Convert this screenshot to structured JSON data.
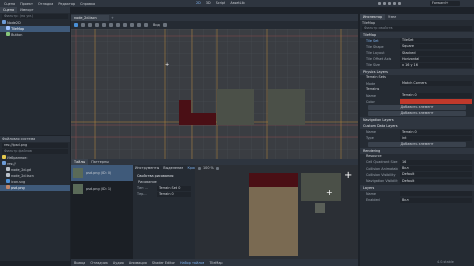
{
  "menu": {
    "items": [
      "Сцена",
      "Проект",
      "Отладка",
      "Редактор",
      "Справка"
    ],
    "scene_tab": "node_2d.tscn",
    "workspaces": [
      "2D",
      "3D",
      "Script",
      "AssetLib"
    ],
    "renderer": "Forward+"
  },
  "scene_dock": {
    "tabs": [
      "Сцена",
      "Импорт"
    ],
    "filter_placeholder": "Фильтр: (по ум.)",
    "nodes": [
      "Node2D",
      "TileMap",
      "Button"
    ]
  },
  "filesystem": {
    "title": "Файловая система",
    "path": "res://ipsd.png",
    "filter_placeholder": "Фильтр файлов",
    "items": [
      "Избранное:",
      "res://",
      "node_2d.gd",
      "node_2d.tscn",
      "icon.svg",
      "psd.png"
    ]
  },
  "viewport": {
    "toolbar": [
      "Вид",
      "Снимок"
    ],
    "zoom": "100 %"
  },
  "bottom_panel": {
    "tabs": [
      "Тайлы",
      "Паттерны"
    ],
    "tiles": [
      {
        "label": "psd.png (ID: 0)"
      },
      {
        "label": "psd.png (ID: 1)"
      }
    ],
    "tool_tabs": [
      "Инструменты",
      "Выделение",
      "Краска"
    ],
    "props_title": "Свойства рисования",
    "props_sub": "Рисование",
    "props": [
      {
        "k": "Тип ...",
        "v": "Terrain Set 0"
      },
      {
        "k": "Тер...",
        "v": "Terrain 0"
      }
    ],
    "atlas_zoom": "100 %"
  },
  "statusbar": {
    "items": [
      "Вывод",
      "Отладчик",
      "Аудио",
      "Анимация",
      "Shader Editor",
      "Набор тайлов",
      "TileMap"
    ],
    "version": "4.0.stable"
  },
  "inspector": {
    "tabs": [
      "Инспектор",
      "Узел"
    ],
    "path": "TileMap",
    "filter_placeholder": "Фильтр свойств",
    "object": "TileMap",
    "tileset_label": "Tile Set",
    "tileset_value": "TileSet",
    "props": [
      {
        "k": "Tile Shape",
        "v": "Square"
      },
      {
        "k": "Tile Layout",
        "v": "Stacked"
      },
      {
        "k": "Tile Offset Axis",
        "v": "Horizontal"
      },
      {
        "k": "Tile Size",
        "v": "x 16  y 16"
      }
    ],
    "sections": [
      {
        "title": "Physics Layers",
        "sub": "Terrain Sets",
        "rows": [
          {
            "k": "Mode",
            "v": "Match Corners"
          }
        ]
      },
      {
        "title": "Terrains",
        "sub": "",
        "rows": [
          {
            "k": "Name",
            "v": "Terrain 0"
          },
          {
            "k": "Color",
            "v": ""
          }
        ]
      }
    ],
    "add_button": "Добавить элемент",
    "add_button_2": "Добавить элемент",
    "nav_layers": "Navigation Layers",
    "custom_layers": "Custom Data Layers",
    "custom_rows": [
      {
        "k": "Name",
        "v": "Terrain 0"
      },
      {
        "k": "Type",
        "v": "int"
      }
    ],
    "add_button_3": "Добавить элемент",
    "rendering": "Rendering",
    "rendering_sub": "Resource",
    "bottom_props": [
      {
        "k": "Cell Quadrant Size",
        "v": "16"
      },
      {
        "k": "Collision Animatable",
        "v": "Вкл"
      },
      {
        "k": "Collision Visibility",
        "v": "Default"
      },
      {
        "k": "Navigation Visibility",
        "v": "Default"
      }
    ],
    "layers": "Layers",
    "layer_rows": [
      {
        "k": "Name",
        "v": ""
      },
      {
        "k": "Enabled",
        "v": "Вкл"
      }
    ]
  },
  "colors": {
    "accent": "#4a8fd6",
    "selection": "#3f5a7a",
    "tile_red": "#4a0f15",
    "tile_gray": "#4b5048"
  }
}
